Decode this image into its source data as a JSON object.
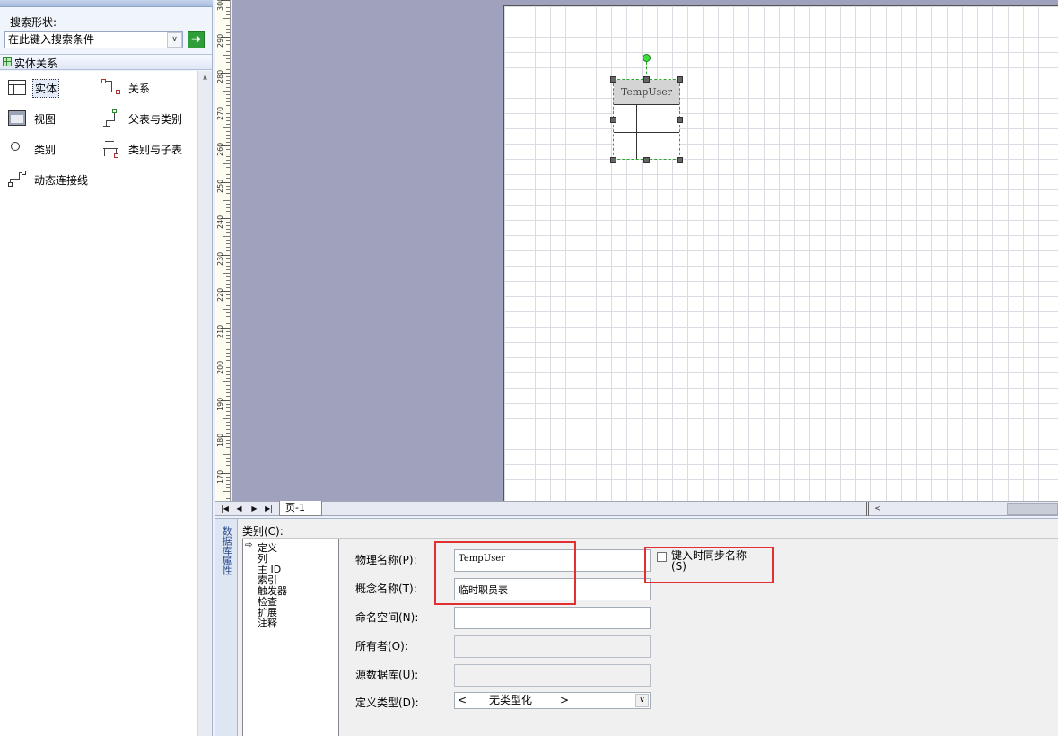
{
  "shapes_panel": {
    "search_label": "搜索形状:",
    "search_placeholder": "在此键入搜索条件",
    "stencil_title": "实体关系",
    "shapes": [
      {
        "label": "实体",
        "icon": "entity-icon"
      },
      {
        "label": "关系",
        "icon": "relationship-icon"
      },
      {
        "label": "视图",
        "icon": "view-icon"
      },
      {
        "label": "父表与类别",
        "icon": "parent-category-icon"
      },
      {
        "label": "类别",
        "icon": "category-icon"
      },
      {
        "label": "类别与子表",
        "icon": "category-child-icon"
      },
      {
        "label": "动态连接线",
        "icon": "dynamic-connector-icon"
      }
    ]
  },
  "ruler": {
    "labels": [
      "300",
      "290",
      "280",
      "270",
      "260",
      "250",
      "240",
      "230",
      "220",
      "210",
      "200",
      "190",
      "180",
      "170"
    ]
  },
  "canvas": {
    "entity_name": "TempUser"
  },
  "tabbar": {
    "page_tab": "页-1"
  },
  "properties": {
    "side_tab": "数据库属性",
    "category_label": "类别(C):",
    "categories": [
      "定义",
      "列",
      "主 ID",
      "索引",
      "触发器",
      "检查",
      "扩展",
      "注释"
    ],
    "physical_name_label": "物理名称(P):",
    "physical_name_value": "TempUser",
    "conceptual_name_label": "概念名称(T):",
    "conceptual_name_value": "临时职员表",
    "namespace_label": "命名空间(N):",
    "namespace_value": "",
    "owner_label": "所有者(O):",
    "source_db_label": "源数据库(U):",
    "def_type_label": "定义类型(D):",
    "def_type_value": "无类型化",
    "sync_label": "键入时同步名称(S)",
    "sync_checked": false
  },
  "colors": {
    "highlight": "#e03030",
    "selection": "#29a329"
  }
}
